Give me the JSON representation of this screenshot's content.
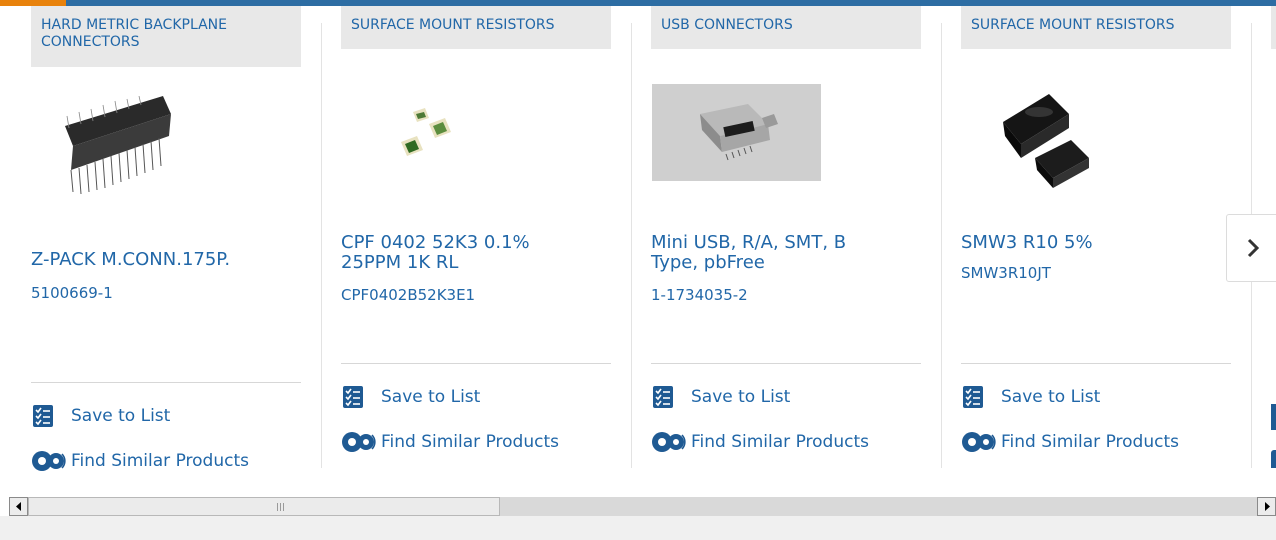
{
  "products": [
    {
      "category": "HARD METRIC BACKPLANE CONNECTORS",
      "image": "backplane-connector-photo",
      "name": "Z-PACK M.CONN.175P.",
      "part_number": "5100669-1",
      "save_label": "Save to List",
      "find_label": "Find Similar Products"
    },
    {
      "category": "SURFACE MOUNT RESISTORS",
      "image": "chip-resistors-photo",
      "name": "CPF 0402 52K3 0.1% 25PPM 1K RL",
      "part_number": "CPF0402B52K3E1",
      "save_label": "Save to List",
      "find_label": "Find Similar Products"
    },
    {
      "category": "USB CONNECTORS",
      "image": "mini-usb-connector-photo",
      "name": "Mini USB, R/A, SMT, B Type, pbFree",
      "part_number": "1-1734035-2",
      "save_label": "Save to List",
      "find_label": "Find Similar Products"
    },
    {
      "category": "SURFACE MOUNT RESISTORS",
      "image": "power-resistor-photo",
      "name": "SMW3 R10 5%",
      "part_number": "SMW3R10JT",
      "save_label": "Save to List",
      "find_label": "Find Similar Products"
    }
  ],
  "icons": {
    "save": "checklist-icon",
    "find": "gears-icon",
    "next": "chevron-right-icon",
    "scroll_left": "arrow-left-icon",
    "scroll_right": "arrow-right-icon"
  },
  "colors": {
    "link": "#2167a8",
    "icon": "#1f5a93",
    "topbar": "#2d6da3",
    "accent": "#e8820c",
    "category_bg": "#e8e8e8"
  }
}
